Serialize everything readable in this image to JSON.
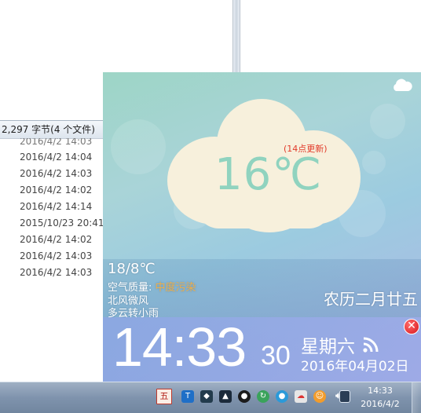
{
  "explorer": {
    "status_text": "2,297 字节(4 个文件)",
    "dates": [
      "2016/4/2 14:03",
      "2016/4/2 14:04",
      "2016/4/2 14:03",
      "2016/4/2 14:02",
      "2016/4/2 14:14",
      "2015/10/23 20:41",
      "2016/4/2 14:02",
      "2016/4/2 14:03",
      "2016/4/2 14:03"
    ]
  },
  "weather": {
    "current_temp": "16℃",
    "update_note": "(14点更新)",
    "temp_range": "18/8℃",
    "air_quality_label": "空气质量: ",
    "air_quality_value": "中度污染",
    "wind": "北风微风",
    "forecast": "多云转小雨",
    "lunar_date": "农历二月廿五",
    "colors": {
      "air_quality": "#f0b04a",
      "update_note": "#e23a2a",
      "temp": "#90d3bf"
    }
  },
  "clock": {
    "hm": "14:33",
    "seconds": "30",
    "weekday": "星期六",
    "date": "2016年04月02日"
  },
  "taskbar": {
    "ime_label": "五",
    "time": "14:33",
    "date": "2016/4/2",
    "tray_icons": [
      "ime-icon",
      "teamviewer-icon",
      "security-icon",
      "monitor-icon",
      "penguin-icon",
      "sync-icon",
      "qq-icon",
      "cloud-icon",
      "cute-app-icon",
      "volume-icon",
      "network-icon"
    ]
  }
}
